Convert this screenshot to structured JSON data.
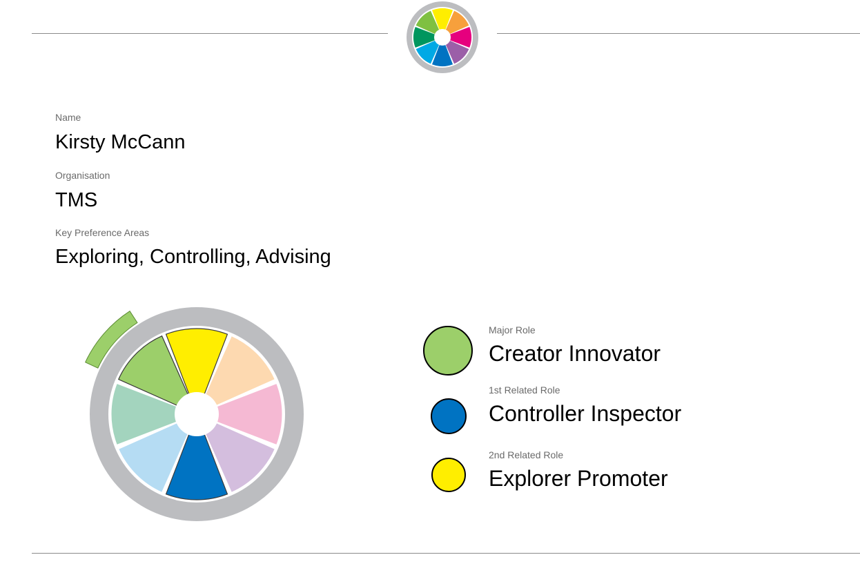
{
  "header": {
    "logo_icon": "tms-team-wheel-logo-icon"
  },
  "profile": {
    "name_label": "Name",
    "name_value": "Kirsty McCann",
    "organisation_label": "Organisation",
    "organisation_value": "TMS",
    "preference_label": "Key Preference Areas",
    "preference_value": "Exploring, Controlling, Advising"
  },
  "wheel": {
    "highlight_color": "#9ccf6a",
    "ring_color": "#bcbdc0",
    "segments": [
      {
        "id": "top",
        "color": "#ffee00",
        "highlighted": true
      },
      {
        "id": "top-right",
        "color": "#fdd9b0",
        "highlighted": false
      },
      {
        "id": "right",
        "color": "#f5b9d3",
        "highlighted": false
      },
      {
        "id": "bottom-right",
        "color": "#d4bede",
        "highlighted": false
      },
      {
        "id": "bottom",
        "color": "#0073c2",
        "highlighted": true
      },
      {
        "id": "bottom-left",
        "color": "#b5dcf3",
        "highlighted": false
      },
      {
        "id": "left",
        "color": "#a3d4be",
        "highlighted": false
      },
      {
        "id": "top-left",
        "color": "#9ccf6a",
        "highlighted": true
      }
    ]
  },
  "roles": [
    {
      "label": "Major Role",
      "value": "Creator Innovator",
      "color": "#9ccf6a"
    },
    {
      "label": "1st Related Role",
      "value": "Controller Inspector",
      "color": "#0073c2"
    },
    {
      "label": "2nd Related Role",
      "value": "Explorer Promoter",
      "color": "#ffee00"
    }
  ]
}
